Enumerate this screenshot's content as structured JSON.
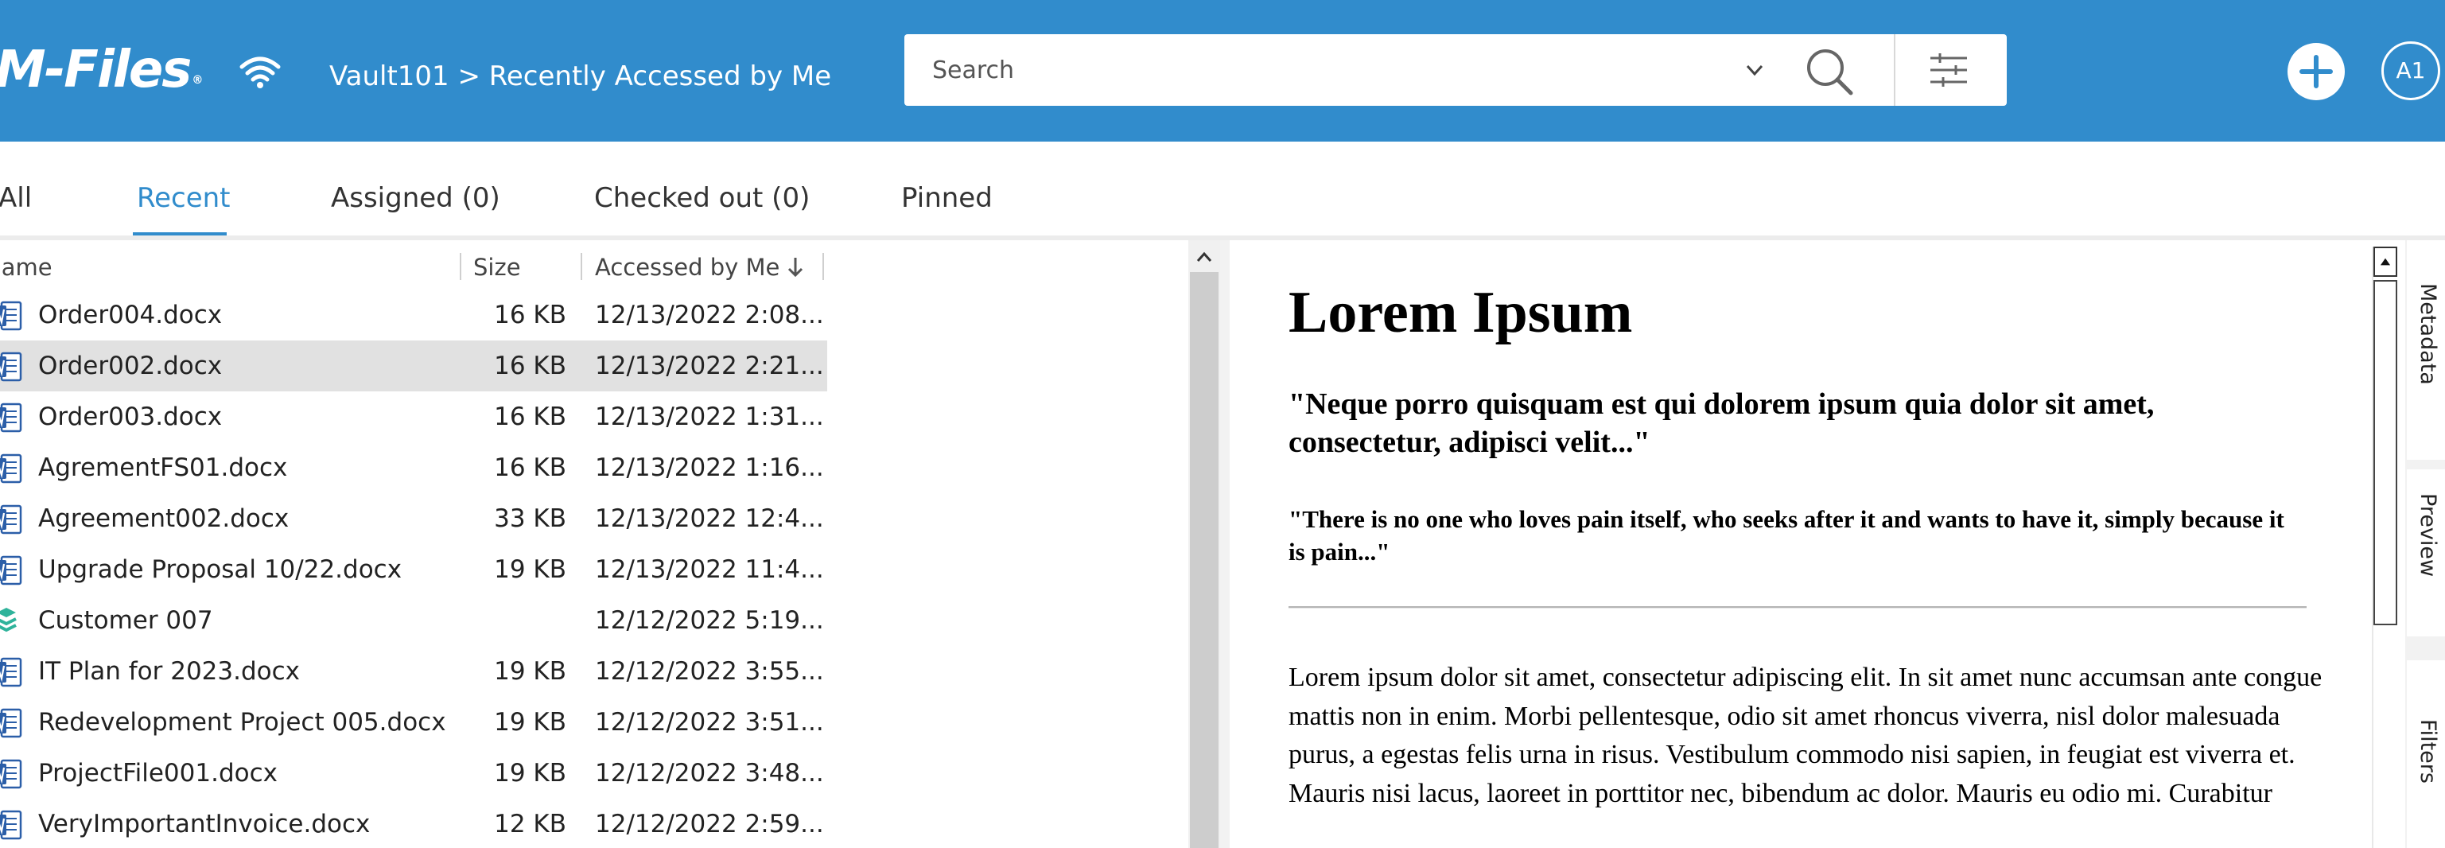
{
  "header": {
    "logo_text": "M-Files",
    "logo_mark": "®",
    "breadcrumb": "Vault101 > Recently Accessed by Me",
    "search_placeholder": "Search",
    "avatar_initials": "A1",
    "colors": {
      "header_bg": "#318CCC",
      "accent": "#318CCC"
    }
  },
  "tabs": [
    {
      "label": "All",
      "active": false
    },
    {
      "label": "Recent",
      "active": true
    },
    {
      "label": "Assigned (0)",
      "active": false
    },
    {
      "label": "Checked out (0)",
      "active": false
    },
    {
      "label": "Pinned",
      "active": false
    }
  ],
  "columns": {
    "name": "Name",
    "size": "Size",
    "accessed": "Accessed by Me"
  },
  "rows": [
    {
      "name": "Order004.docx",
      "size": "16 KB",
      "accessed": "12/13/2022 2:08...",
      "icon": "word-doc-icon",
      "selected": false
    },
    {
      "name": "Order002.docx",
      "size": "16 KB",
      "accessed": "12/13/2022 2:21...",
      "icon": "word-doc-icon",
      "selected": true
    },
    {
      "name": "Order003.docx",
      "size": "16 KB",
      "accessed": "12/13/2022 1:31...",
      "icon": "word-doc-icon",
      "selected": false
    },
    {
      "name": "AgrementFS01.docx",
      "size": "16 KB",
      "accessed": "12/13/2022 1:16...",
      "icon": "word-doc-icon",
      "selected": false
    },
    {
      "name": "Agreement002.docx",
      "size": "33 KB",
      "accessed": "12/13/2022 12:4...",
      "icon": "word-doc-icon",
      "selected": false
    },
    {
      "name": "Upgrade Proposal 10/22.docx",
      "size": "19 KB",
      "accessed": "12/13/2022 11:4...",
      "icon": "word-doc-icon",
      "selected": false
    },
    {
      "name": "Customer 007",
      "size": "",
      "accessed": "12/12/2022 5:19...",
      "icon": "customer-object-icon",
      "selected": false
    },
    {
      "name": "IT Plan for 2023.docx",
      "size": "19 KB",
      "accessed": "12/12/2022 3:55...",
      "icon": "word-doc-icon",
      "selected": false
    },
    {
      "name": "Redevelopment Project 005.docx",
      "size": "19 KB",
      "accessed": "12/12/2022 3:51...",
      "icon": "word-doc-icon",
      "selected": false
    },
    {
      "name": "ProjectFile001.docx",
      "size": "19 KB",
      "accessed": "12/12/2022 3:48...",
      "icon": "word-doc-icon",
      "selected": false
    },
    {
      "name": "VeryImportantInvoice.docx",
      "size": "12 KB",
      "accessed": "12/12/2022 2:59...",
      "icon": "word-doc-icon",
      "selected": false
    }
  ],
  "preview": {
    "title": "Lorem Ipsum",
    "quote1": "\"Neque porro quisquam est qui dolorem ipsum quia dolor sit amet, consectetur, adipisci velit...\"",
    "quote2": "\"There is no one who loves pain itself, who seeks after it and wants to have it, simply because it is pain...\"",
    "body": "Lorem ipsum dolor sit amet, consectetur adipiscing elit. In sit amet nunc accumsan ante congue mattis non in enim. Morbi pellentesque, odio sit amet rhoncus viverra, nisl dolor malesuada purus, a egestas felis urna in risus. Vestibulum commodo nisi sapien, in feugiat est viverra et. Mauris nisi lacus, laoreet in porttitor nec, bibendum ac dolor. Mauris eu odio mi. Curabitur"
  },
  "right_rail": {
    "metadata": "Metadata",
    "preview": "Preview",
    "filters": "Filters"
  }
}
